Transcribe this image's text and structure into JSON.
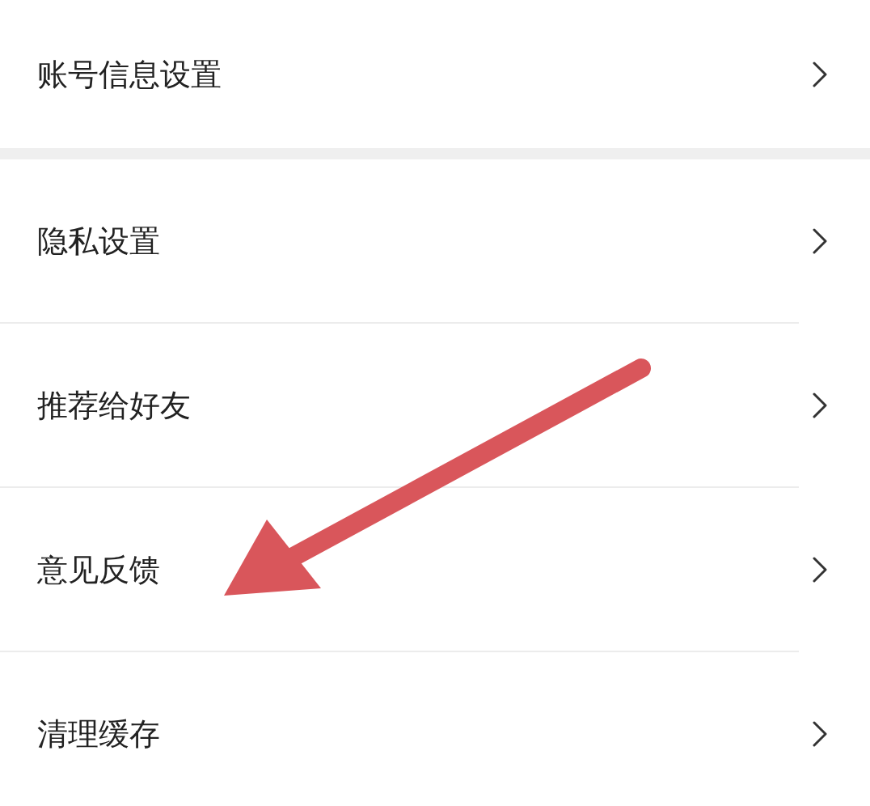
{
  "sections": [
    {
      "items": [
        {
          "label": "账号信息设置"
        }
      ]
    },
    {
      "items": [
        {
          "label": "隐私设置"
        },
        {
          "label": "推荐给好友"
        },
        {
          "label": "意见反馈"
        },
        {
          "label": "清理缓存"
        }
      ]
    }
  ]
}
